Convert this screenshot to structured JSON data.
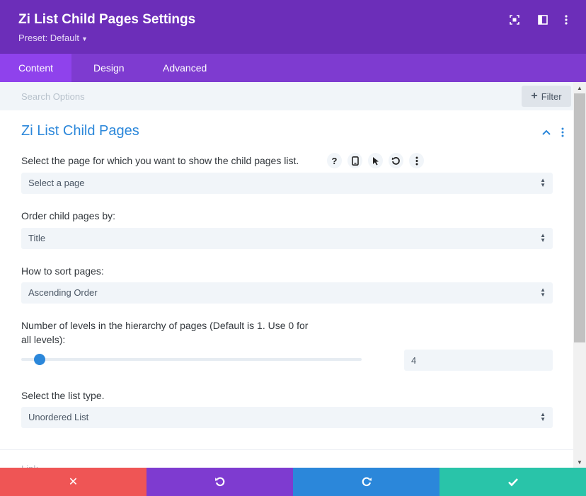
{
  "header": {
    "title": "Zi List Child Pages Settings",
    "preset_label": "Preset: Default",
    "bg_color": "#6c2eb9"
  },
  "tabs": [
    {
      "label": "Content",
      "active": true
    },
    {
      "label": "Design",
      "active": false
    },
    {
      "label": "Advanced",
      "active": false
    }
  ],
  "search": {
    "placeholder": "Search Options",
    "filter_label": "Filter"
  },
  "section": {
    "title": "Zi List Child Pages",
    "title_color": "#2b87da"
  },
  "fields": {
    "page": {
      "label": "Select the page for which you want to show the child pages list.",
      "value": "Select a page"
    },
    "order": {
      "label": "Order child pages by:",
      "value": "Title"
    },
    "sort": {
      "label": "How to sort pages:",
      "value": "Ascending Order"
    },
    "levels": {
      "label_line1": "Number of levels in the hierarchy of pages (Default is 1. Use 0 for",
      "label_line2": "all levels):",
      "value": "4"
    },
    "list_type": {
      "label": "Select the list type.",
      "value": "Unordered List"
    }
  },
  "field_icons": [
    "help-icon",
    "mobile-icon",
    "cursor-icon",
    "reset-icon",
    "more-icon"
  ],
  "next_section_label": "Link",
  "footer": {
    "discard_color": "#ef5555",
    "undo_color": "#7e3bd0",
    "redo_color": "#2b87da",
    "save_color": "#29c4a9"
  }
}
